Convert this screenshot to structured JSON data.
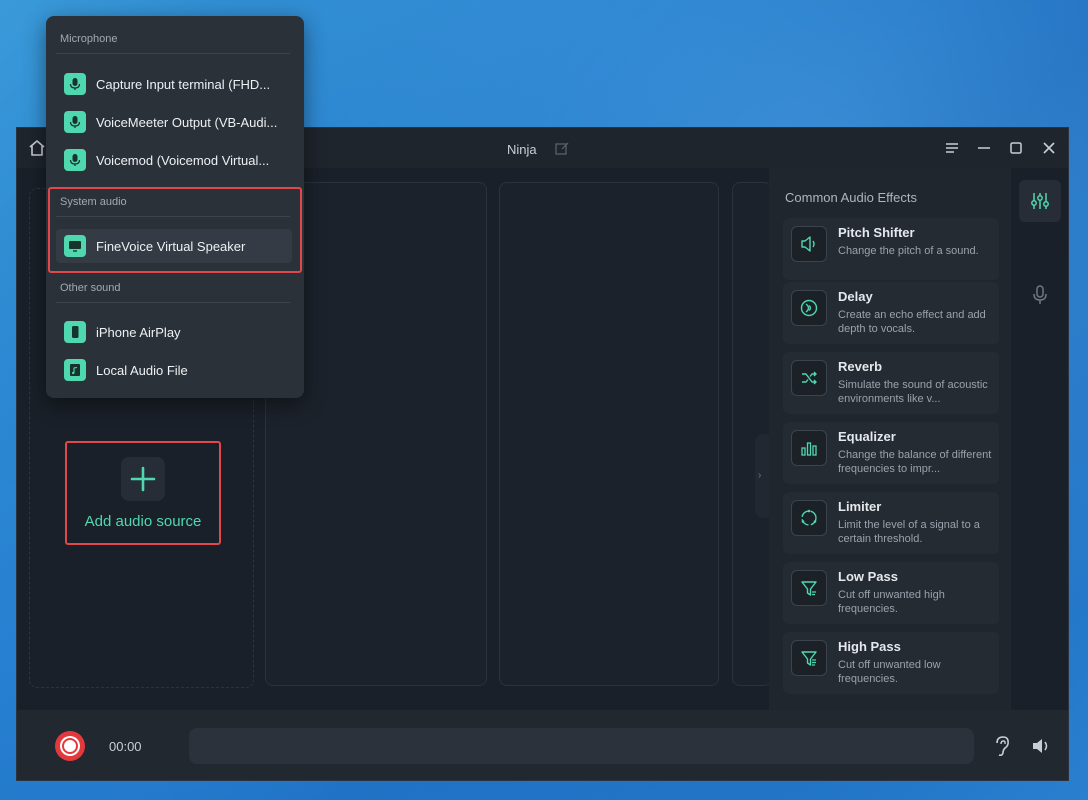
{
  "window": {
    "title": "Ninja"
  },
  "dropdown": {
    "sections": {
      "microphone": "Microphone",
      "system_audio": "System audio",
      "other_sound": "Other sound"
    },
    "microphone_items": [
      {
        "label": "Capture Input terminal (FHD...",
        "icon": "microphone-icon"
      },
      {
        "label": "VoiceMeeter Output (VB-Audi...",
        "icon": "microphone-icon"
      },
      {
        "label": "Voicemod (Voicemod Virtual...",
        "icon": "microphone-icon"
      }
    ],
    "system_items": [
      {
        "label": "FineVoice Virtual Speaker",
        "icon": "monitor-icon"
      }
    ],
    "other_items": [
      {
        "label": "iPhone AirPlay",
        "icon": "phone-icon"
      },
      {
        "label": "Local Audio File",
        "icon": "music-file-icon"
      }
    ]
  },
  "main": {
    "add_source_label": "Add audio source"
  },
  "effects": {
    "title": "Common Audio Effects",
    "items": [
      {
        "name": "Pitch Shifter",
        "desc": "Change the pitch of a sound.",
        "icon": "speaker-icon"
      },
      {
        "name": "Delay",
        "desc": "Create an echo effect and add depth to vocals.",
        "icon": "echo-icon"
      },
      {
        "name": "Reverb",
        "desc": "Simulate the sound of acoustic environments like v...",
        "icon": "shuffle-icon"
      },
      {
        "name": "Equalizer",
        "desc": "Change the balance of different frequencies to impr...",
        "icon": "bars-icon"
      },
      {
        "name": "Limiter",
        "desc": "Limit the level of a signal to a certain threshold.",
        "icon": "circle-arrows-icon"
      },
      {
        "name": "Low Pass",
        "desc": "Cut off unwanted high frequencies.",
        "icon": "filter-icon"
      },
      {
        "name": "High Pass",
        "desc": "Cut off unwanted low frequencies.",
        "icon": "filter-icon"
      }
    ]
  },
  "bottom": {
    "timer": "00:00"
  },
  "colors": {
    "accent": "#4fd8b0",
    "record": "#e2393c",
    "highlight": "#e0484c"
  }
}
